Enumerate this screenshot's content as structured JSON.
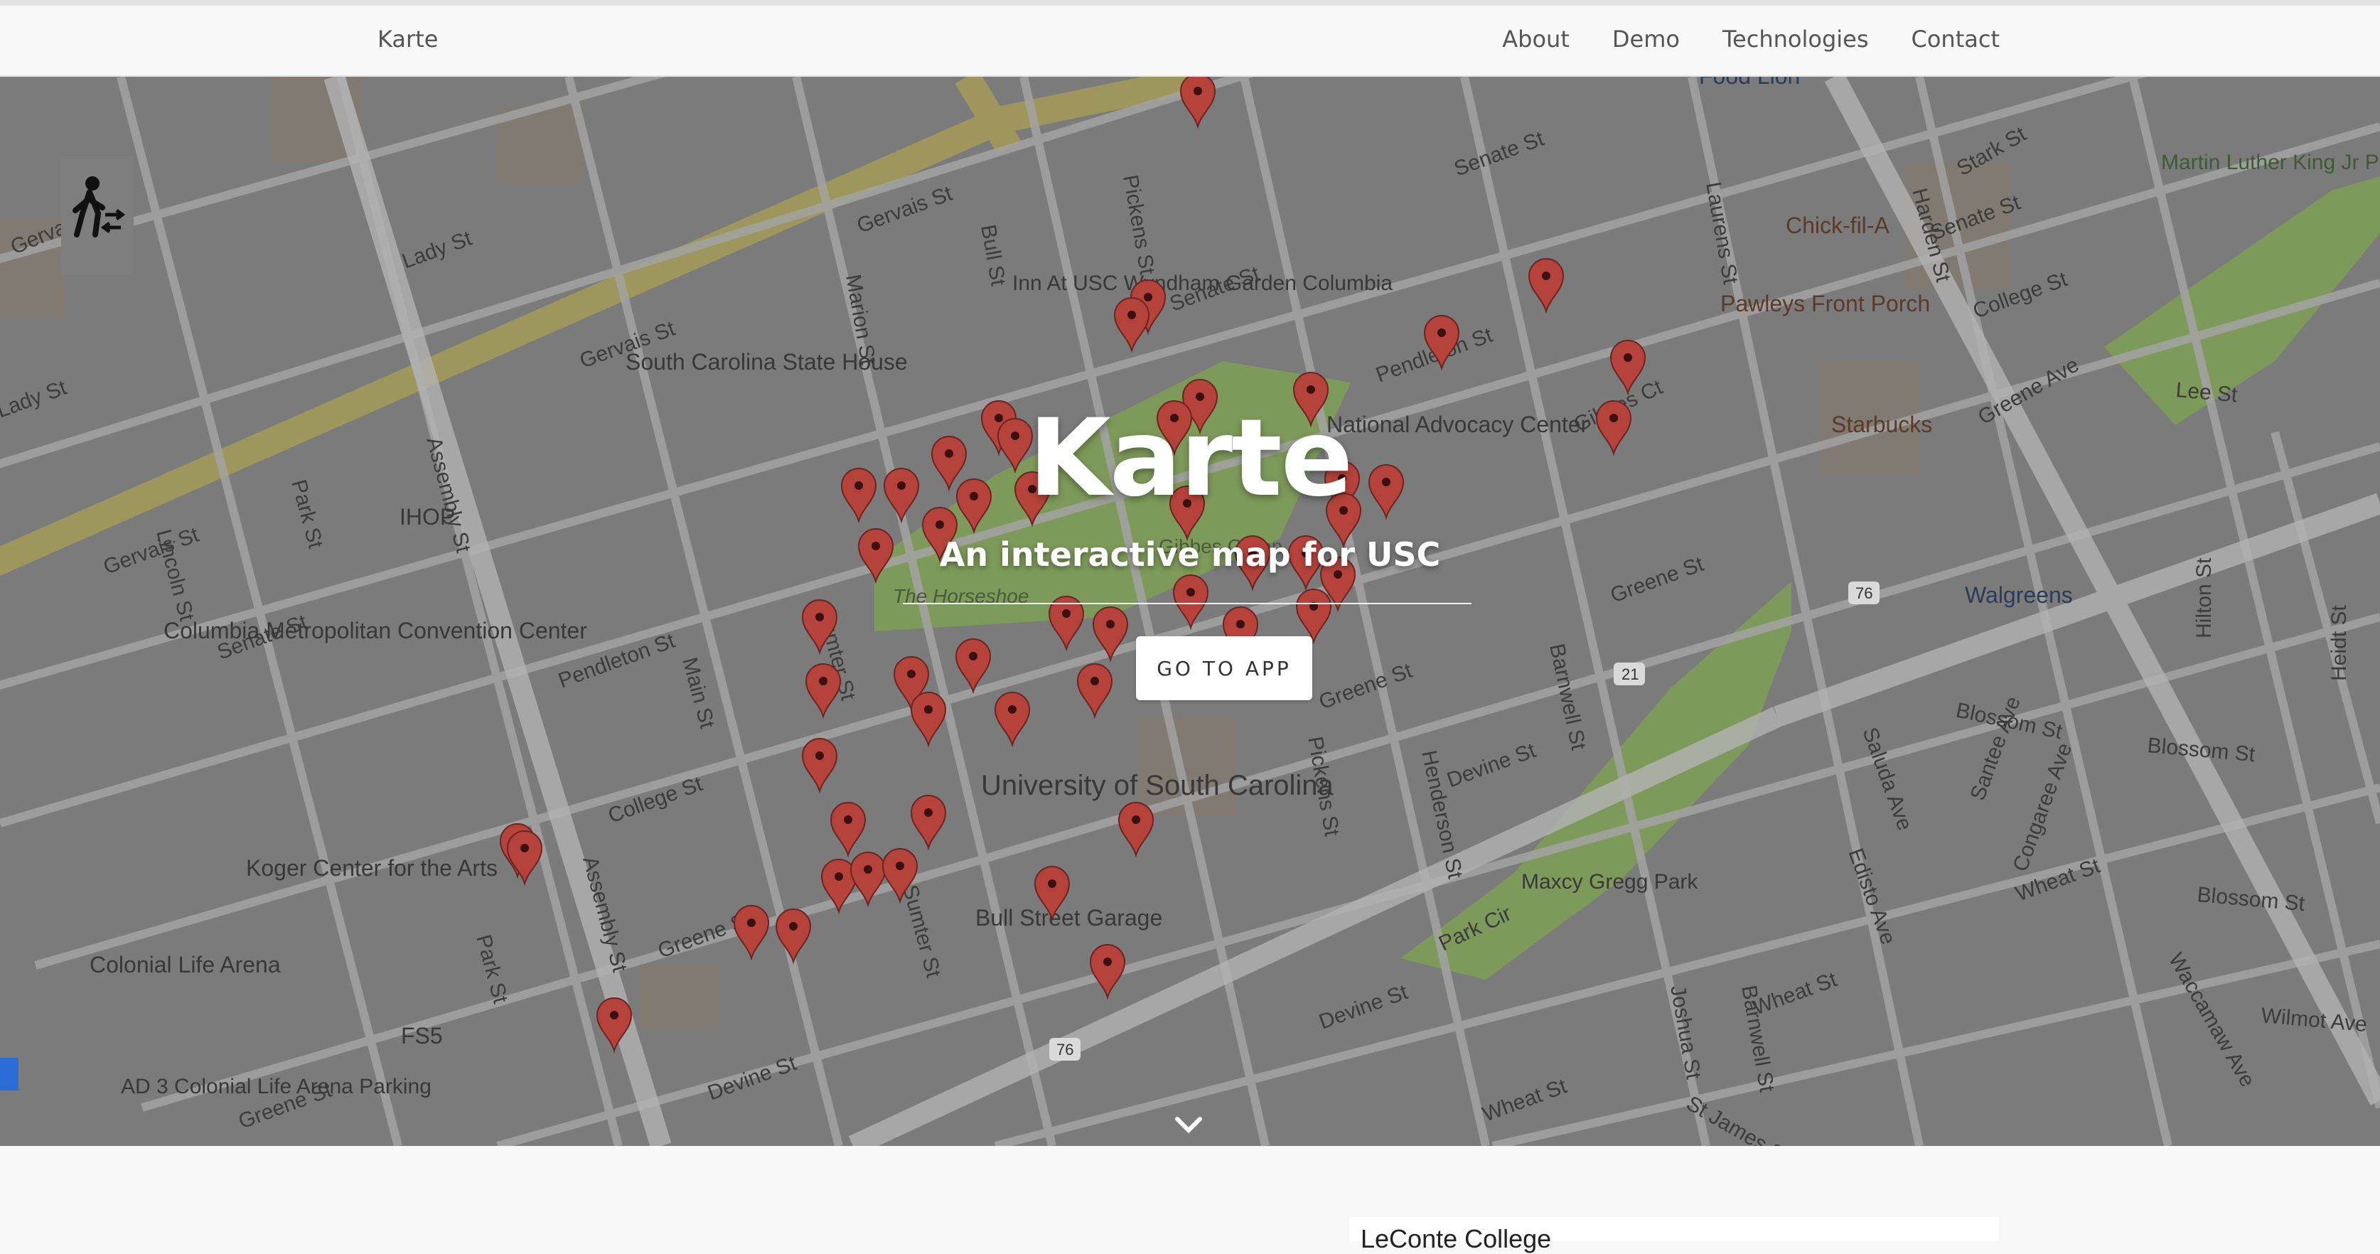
{
  "navbar": {
    "brand": "Karte",
    "links": [
      "About",
      "Demo",
      "Technologies",
      "Contact"
    ]
  },
  "hero": {
    "title": "Karte",
    "subtitle": "An interactive map for USC",
    "button_label": "GO TO APP",
    "scroll_icon": "chevron-down-icon"
  },
  "map": {
    "street_labels": [
      "Gervais St",
      "Gervais St",
      "Gervais St",
      "Gervais St",
      "Lady St",
      "Lady St",
      "Senate St",
      "Senate St",
      "Senate St",
      "Senate St",
      "Pendleton St",
      "Pendleton St",
      "College St",
      "College St",
      "Greene St",
      "Greene St",
      "Greene St",
      "Greene St",
      "Devine St",
      "Devine St",
      "Devine St",
      "Blossom St",
      "Blossom St",
      "Blossom St",
      "Wheat St",
      "Wheat St",
      "Wheat St",
      "Wilmot Ave",
      "Marion St",
      "Bull St",
      "Pickens St",
      "Assembly St",
      "Assembly St",
      "Park St",
      "Park St",
      "Lincoln St",
      "Main St",
      "Sumter St",
      "Henderson St",
      "Barnwell St",
      "Laurens St",
      "Harden St",
      "Saluda Ave",
      "Santee Ave",
      "Congaree Ave",
      "Edisto Ave",
      "Waccamaw Ave",
      "Hilton St",
      "Heidt St",
      "Stark St",
      "Lee St",
      "Gibbes Ct",
      "Park Cir",
      "Joshua St",
      "Barnwell St",
      "St James St",
      "Greene Ave",
      "Sumter St",
      "Pickens St"
    ],
    "poi_labels": [
      "South Carolina State House",
      "IHOP",
      "Columbia Metropolitan Convention Center",
      "Koger Center for the Arts",
      "Colonial Life Arena",
      "FS5",
      "AD 3 Colonial Life Arena Parking",
      "Inn At USC Wyndham Garden Columbia",
      "National Advocacy Center",
      "University of South Carolina",
      "Bull Street Garage",
      "Maxcy Gregg Park",
      "Martin Luther King Jr Park",
      "Chick-fil-A",
      "Pawleys Front Porch",
      "Starbucks",
      "Walgreens",
      "Food Lion",
      "The Horseshoe",
      "Gibbes Green"
    ],
    "road_shields": [
      "76",
      "21",
      "76"
    ]
  },
  "content": {
    "card_title": "LeConte College"
  },
  "colors": {
    "marker": "#b5433b",
    "map_overlay": "#7b7b7b",
    "park": "#7e9a5a",
    "navbar_bg": "#f8f8f8"
  }
}
